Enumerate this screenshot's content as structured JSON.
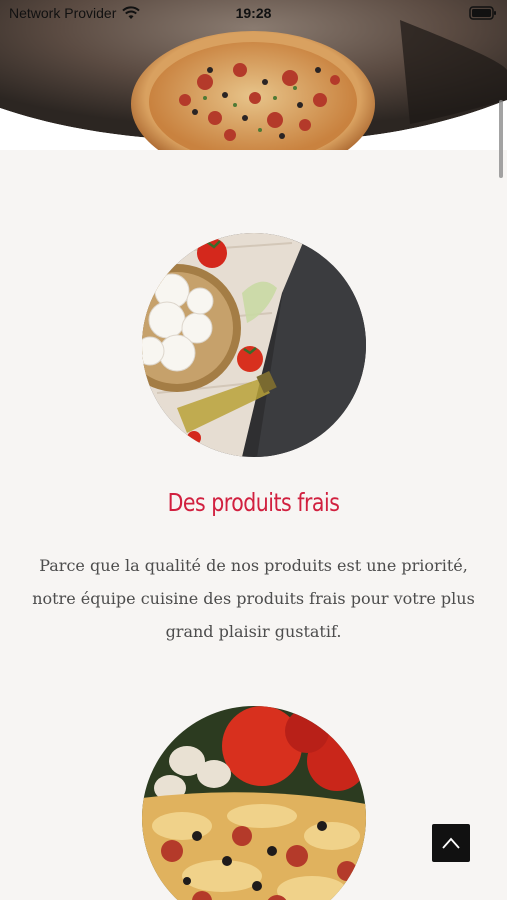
{
  "status_bar": {
    "carrier": "Network Provider",
    "time": "19:28",
    "wifi_icon": "wifi-icon",
    "battery_icon": "battery-icon"
  },
  "hero": {
    "image": "pizza-top-view",
    "colors": {
      "crust": "#c98a4a",
      "sauce": "#b43a2a",
      "background": "#4a3b34"
    }
  },
  "features": [
    {
      "image": "mozzarella-tomatoes-oil-on-cloth",
      "title": "Des produits frais",
      "text": "Parce que la qualité de nos produits est une priorité, notre équipe cuisine des produits frais pour votre plus grand plaisir gustatif."
    },
    {
      "image": "pizza-with-tomatoes-and-mushrooms"
    }
  ],
  "back_to_top": {
    "icon": "chevron-up-icon"
  },
  "theme": {
    "accent": "#d1203f",
    "background": "#f7f5f3",
    "text": "#4d4d4d"
  }
}
